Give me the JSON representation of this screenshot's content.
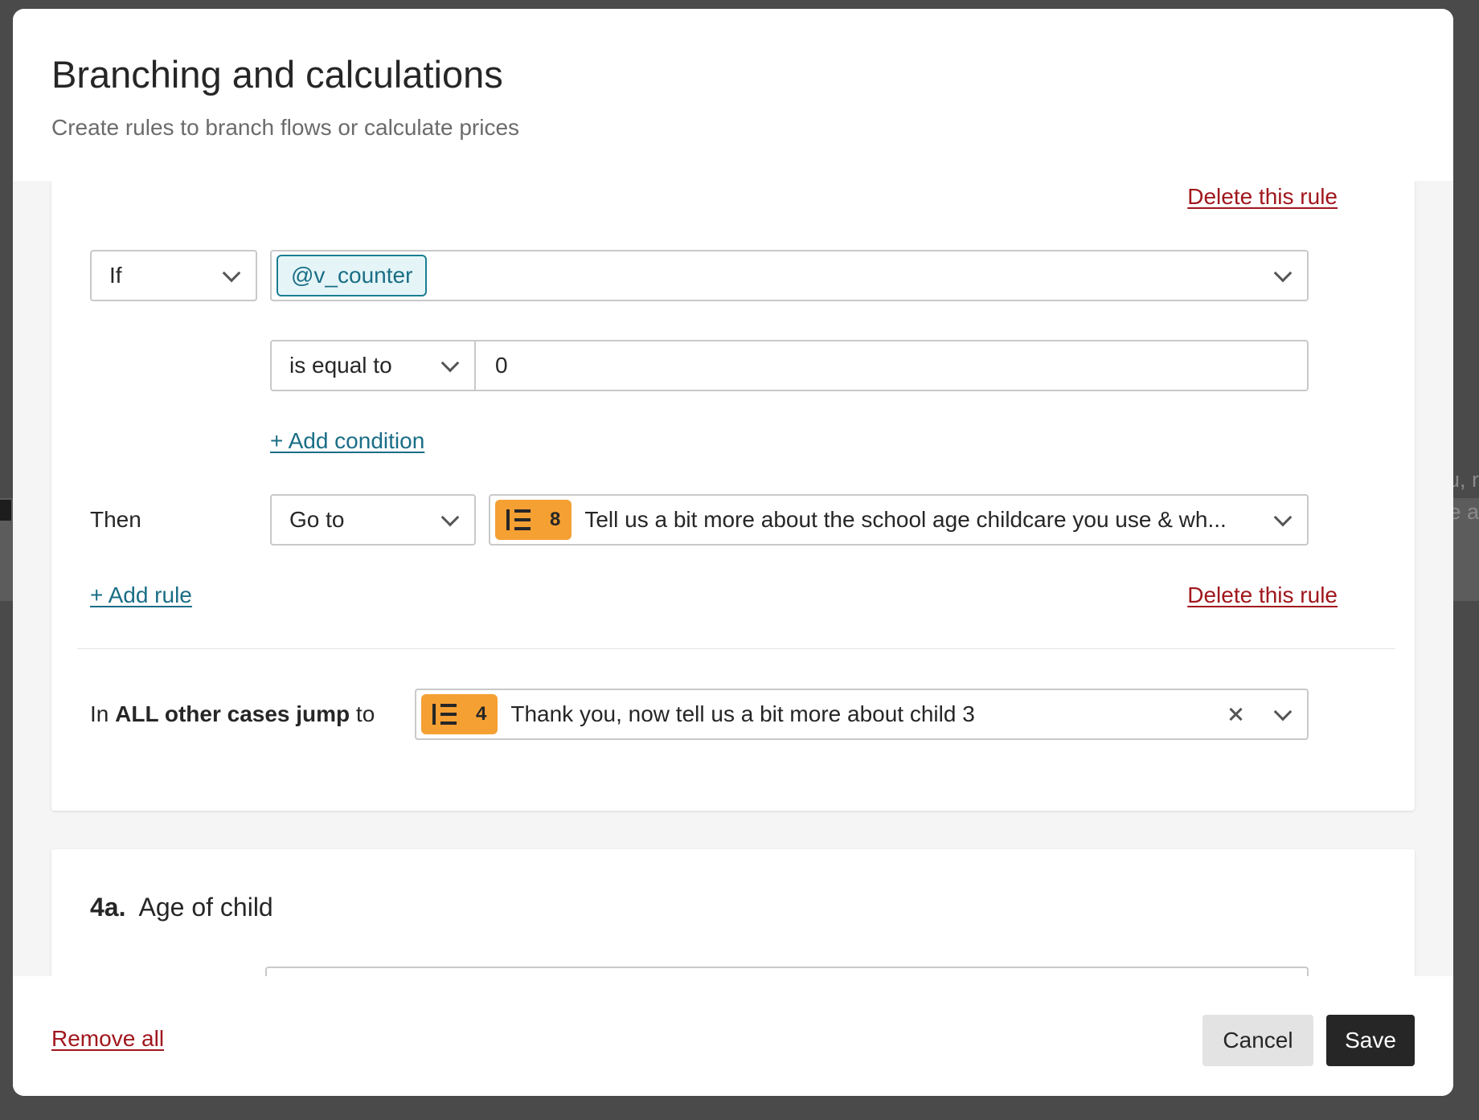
{
  "backdrop": {
    "right_text_1": "u, r",
    "right_text_2": "e a"
  },
  "modal": {
    "title": "Branching and calculations",
    "subtitle": "Create rules to branch flows or calculate prices"
  },
  "rule": {
    "delete_top_label": "Delete this rule",
    "if_select": "If",
    "variable_tag": "@v_counter",
    "operator_select": "is equal to",
    "value_input": "0",
    "add_condition_label": "+ Add condition",
    "then_label": "Then",
    "action_select": "Go to",
    "target": {
      "number": "8",
      "text": "Tell us a bit more about the school age childcare you use & wh..."
    },
    "add_rule_label": "+ Add rule",
    "delete_bottom_label": "Delete this rule"
  },
  "fallback": {
    "label_prefix": "In ",
    "label_bold": "ALL other cases jump",
    "label_suffix": " to",
    "target": {
      "number": "4",
      "text": "Thank you, now tell us a bit more about child 3"
    }
  },
  "next_question": {
    "number": "4a.",
    "title": "Age of child"
  },
  "footer": {
    "remove_all_label": "Remove all",
    "cancel_label": "Cancel",
    "save_label": "Save"
  },
  "colors": {
    "accent_teal": "#1a6e86",
    "danger_red": "#a0171d",
    "block_orange": "#f5a033",
    "primary_dark": "#262627"
  }
}
